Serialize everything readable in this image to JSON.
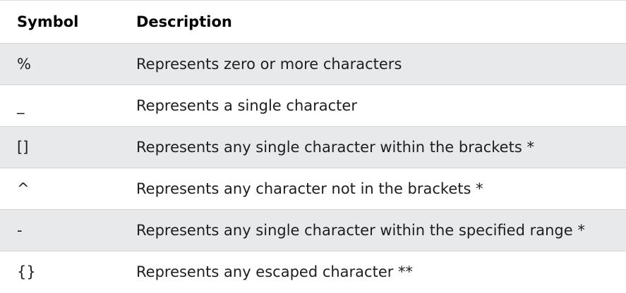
{
  "table": {
    "headers": {
      "symbol": "Symbol",
      "description": "Description"
    },
    "rows": [
      {
        "symbol": "%",
        "description": "Represents zero or more characters"
      },
      {
        "symbol": "_",
        "description": "Represents a single character"
      },
      {
        "symbol": "[]",
        "description": "Represents any single character within the brackets *"
      },
      {
        "symbol": "^",
        "description": "Represents any character not in the brackets *"
      },
      {
        "symbol": "-",
        "description": "Represents any single character within the specified range *"
      },
      {
        "symbol": "{}",
        "description": "Represents any escaped character **"
      }
    ]
  },
  "colors": {
    "stripe": "#e7e9eb",
    "text": "#1e1e1e",
    "border": "#d4d4d4"
  }
}
